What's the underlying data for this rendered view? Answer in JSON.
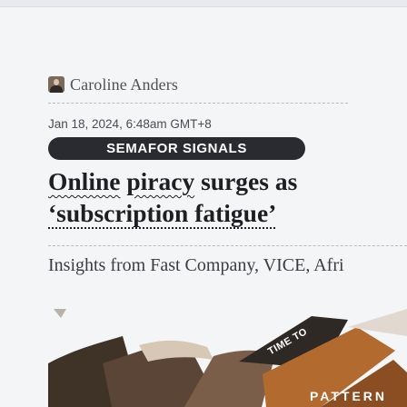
{
  "article": {
    "author": {
      "name": "Caroline Anders",
      "avatar_icon": "author-photo-icon"
    },
    "timestamp": "Jan 18, 2024, 6:48am GMT+8",
    "source_tag": "SEMAFOR SIGNALS",
    "headline": {
      "part1": "Online",
      "part2": "piracy",
      "part3": "surges as",
      "line2": "‘subscription fatigue’"
    },
    "dek": "Insights from Fast Company, VICE, Afri",
    "hero_image": {
      "sign_text": "TIME TO",
      "sign_text2": "PATTERN"
    }
  }
}
